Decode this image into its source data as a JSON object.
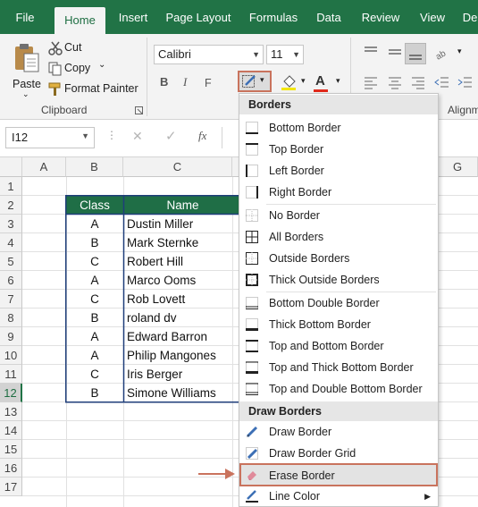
{
  "tabs": [
    "File",
    "Home",
    "Insert",
    "Page Layout",
    "Formulas",
    "Data",
    "Review",
    "View",
    "De"
  ],
  "active_tab": "Home",
  "clipboard": {
    "paste_label": "Paste",
    "cut_label": "Cut",
    "copy_label": "Copy",
    "format_painter_label": "Format Painter",
    "group_label": "Clipboard"
  },
  "font": {
    "font_name": "Calibri",
    "font_size": "11",
    "bold": "B",
    "italic": "I",
    "group_label_fragment": "F"
  },
  "alignment": {
    "group_label_fragment": "Alignm"
  },
  "formula_bar": {
    "name_box": "I12",
    "cancel_symbol": "✕",
    "enter_symbol": "✓",
    "fx_label": "fx",
    "value": ""
  },
  "columns": [
    "A",
    "B",
    "C",
    "G"
  ],
  "rows": [
    "1",
    "2",
    "3",
    "4",
    "5",
    "6",
    "7",
    "8",
    "9",
    "10",
    "11",
    "12",
    "13",
    "14",
    "15",
    "16",
    "17"
  ],
  "selected_row": "12",
  "table": {
    "headers": [
      "Class",
      "Name"
    ],
    "rows": [
      [
        "A",
        "Dustin Miller"
      ],
      [
        "B",
        "Mark Sternke"
      ],
      [
        "C",
        "Robert Hill"
      ],
      [
        "A",
        "Marco Ooms"
      ],
      [
        "C",
        "Rob Lovett"
      ],
      [
        "B",
        "roland dv"
      ],
      [
        "A",
        "Edward Barron"
      ],
      [
        "A",
        "Philip Mangones"
      ],
      [
        "C",
        "Iris Berger"
      ],
      [
        "B",
        "Simone Williams"
      ]
    ]
  },
  "borders_menu": {
    "section_borders": "Borders",
    "section_draw": "Draw Borders",
    "items": [
      "Bottom Border",
      "Top Border",
      "Left Border",
      "Right Border",
      "No Border",
      "All Borders",
      "Outside Borders",
      "Thick Outside Borders",
      "Bottom Double Border",
      "Thick Bottom Border",
      "Top and Bottom Border",
      "Top and Thick Bottom Border",
      "Top and Double Bottom Border"
    ],
    "draw_items": [
      "Draw Border",
      "Draw Border Grid",
      "Erase Border",
      "Line Color"
    ],
    "highlighted_item": "Erase Border"
  },
  "colors": {
    "excel_green": "#217346",
    "table_header_bg": "#1f6e46",
    "table_border": "#1f3e7a",
    "highlight_outline": "#c9735d",
    "arrow": "#c9735d"
  }
}
